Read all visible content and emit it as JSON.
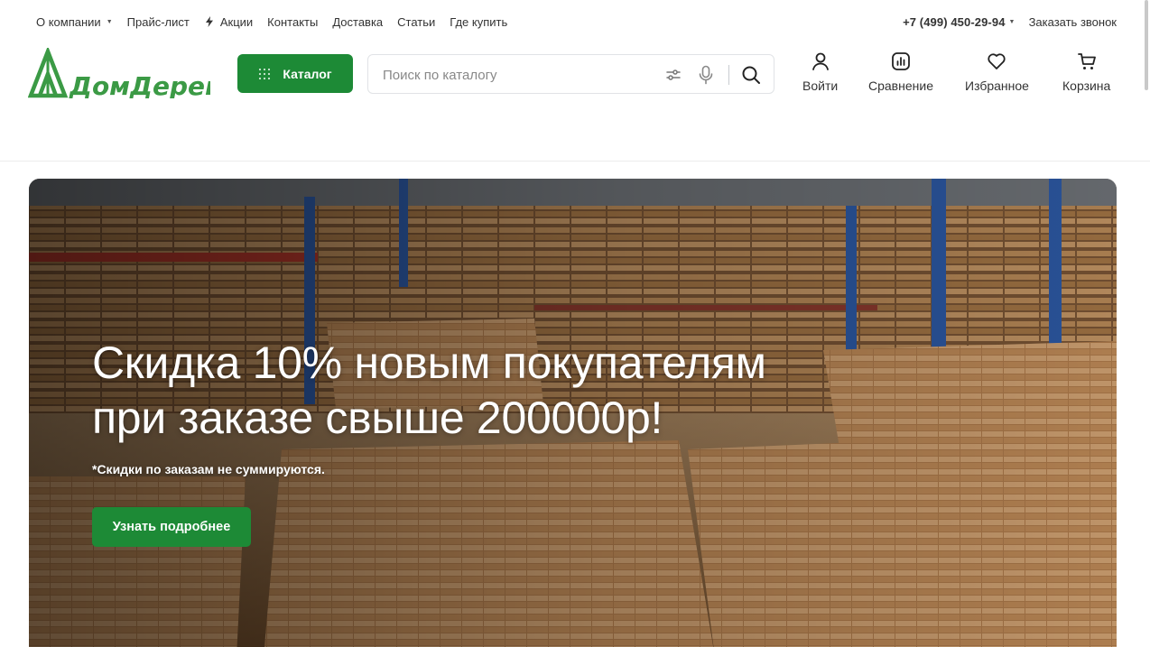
{
  "top_nav": {
    "items": [
      {
        "label": "О компании",
        "has_dropdown": true
      },
      {
        "label": "Прайс-лист"
      },
      {
        "label": "Акции",
        "icon": "bolt-icon"
      },
      {
        "label": "Контакты"
      },
      {
        "label": "Доставка"
      },
      {
        "label": "Статьи"
      },
      {
        "label": "Где купить"
      }
    ],
    "phone": "+7 (499) 450-29-94",
    "callback_label": "Заказать звонок"
  },
  "header": {
    "logo_text": "ДомДерева",
    "catalog_label": "Каталог",
    "search_placeholder": "Поиск по каталогу",
    "actions": [
      {
        "label": "Войти",
        "icon": "user-icon"
      },
      {
        "label": "Сравнение",
        "icon": "compare-chart-icon"
      },
      {
        "label": "Избранное",
        "icon": "heart-icon"
      },
      {
        "label": "Корзина",
        "icon": "cart-icon"
      }
    ]
  },
  "hero": {
    "title_line1": "Скидка 10% новым покупателям",
    "title_line2": "при заказе свыше 200000р!",
    "note": "*Скидки по заказам не суммируются.",
    "cta_label": "Узнать подробнее"
  },
  "colors": {
    "brand_green": "#1d8a36",
    "logo_green": "#3b9a45",
    "text": "#333333"
  }
}
